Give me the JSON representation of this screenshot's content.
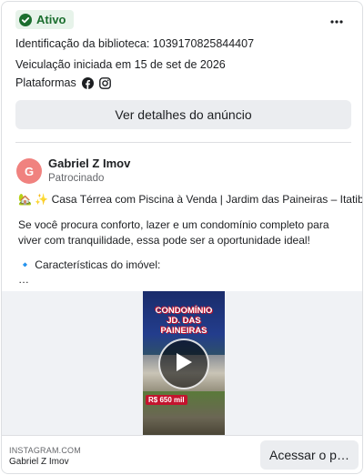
{
  "status": {
    "label": "Ativo",
    "icon": "check-circle-icon",
    "color": "#1b6e2e"
  },
  "menu": {
    "icon": "more-horizontal-icon"
  },
  "library_id": "Identificação da biblioteca: 1039170825844407",
  "started": "Veiculação iniciada em 15 de set de 2026",
  "platforms": {
    "label": "Plataformas",
    "icons": [
      "facebook-icon",
      "instagram-icon"
    ]
  },
  "details_button": "Ver detalhes do anúncio",
  "ad": {
    "advertiser": "Gabriel Z Imov",
    "avatar_letter": "G",
    "avatar_color": "#f0827f",
    "sponsored": "Patrocinado",
    "headline_emoji": "🏡 ✨",
    "headline": "Casa Térrea com Piscina à Venda | Jardim das Paineiras – Itatiba/SP",
    "body": "Se você procura conforto, lazer e um condomínio completo para viver com tranquilidade, essa pode ser a oportunidade ideal!",
    "features_bullet": "🔹",
    "features": "Características do imóvel:",
    "ellipsis": "…"
  },
  "video": {
    "title_line1": "CONDOMÍNIO",
    "title_line2": "JD. DAS PAINEIRAS",
    "price": "R$ 650 mil",
    "play_icon": "play-icon"
  },
  "footer": {
    "domain": "INSTAGRAM.COM",
    "name": "Gabriel Z Imov",
    "cta": "Acessar o p…"
  }
}
